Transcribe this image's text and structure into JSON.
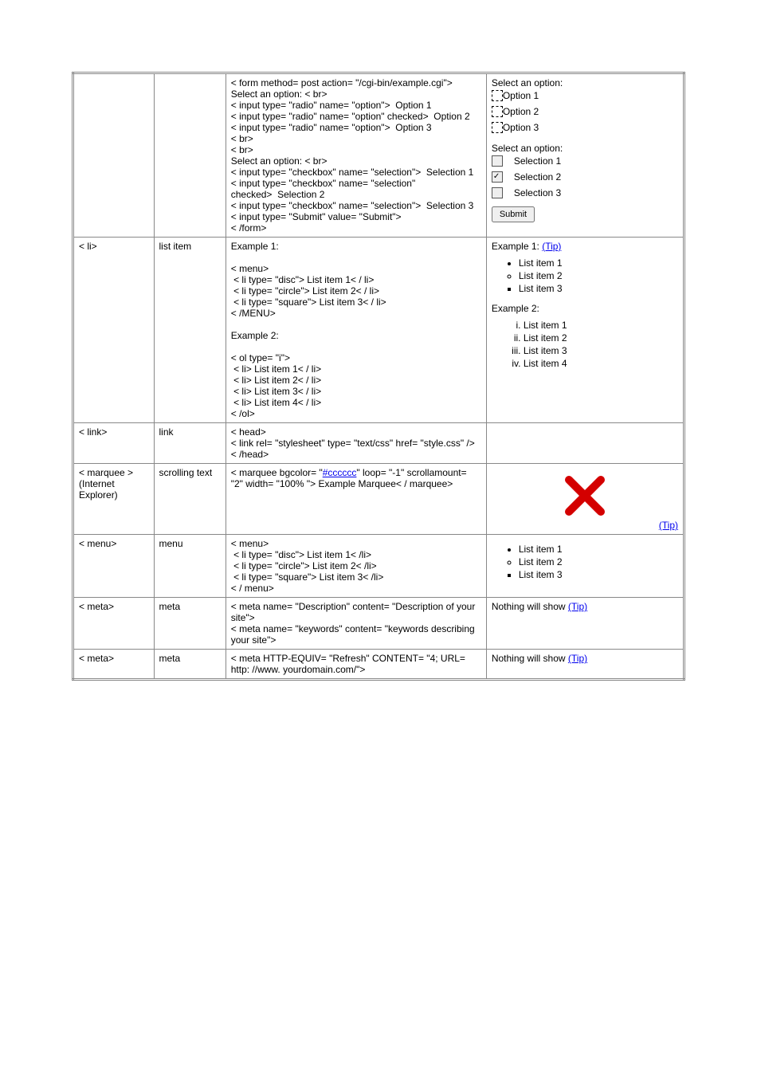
{
  "rows": {
    "form": {
      "code": "< form method= post action= \"/cgi-bin/example.cgi\">\nSelect an option: < br>\n< input type= \"radio\" name= \"option\">  Option 1\n< input type= \"radio\" name= \"option\" checked>  Option 2\n< input type= \"radio\" name= \"option\">  Option 3\n< br>\n< br>\nSelect an option: < br>\n< input type= \"checkbox\" name= \"selection\">  Selection 1\n< input type= \"checkbox\" name= \"selection\" checked>  Selection 2\n< input type= \"checkbox\" name= \"selection\">  Selection 3\n< input type= \"Submit\" value= \"Submit\">\n< /form>",
      "preview": {
        "radio_label": "Select an option:",
        "options": [
          "Option 1",
          "Option 2",
          "Option 3"
        ],
        "check_label": "Select an option:",
        "selections": [
          "Selection 1",
          "Selection 2",
          "Selection 3"
        ],
        "submit": "Submit"
      }
    },
    "li": {
      "tag": "< li>",
      "name": "list item",
      "code1_label": "Example 1:",
      "code1": "< menu>\n < li type= \"disc\"> List item 1< / li>\n < li type= \"circle\"> List item 2< / li>\n < li type= \"square\"> List item 3< / li>\n< /MENU>",
      "code2_label": "Example 2:",
      "code2": "< ol type= \"i\">\n < li> List item 1< / li>\n < li> List item 2< / li>\n < li> List item 3< / li>\n < li> List item 4< / li>\n< /ol>",
      "preview1_label": "Example 1:",
      "tip": "(Tip)",
      "list1": [
        "List item 1",
        "List item 2",
        "List item 3"
      ],
      "preview2_label": "Example 2:",
      "list2": [
        "List item 1",
        "List item 2",
        "List item 3",
        "List item 4"
      ]
    },
    "link": {
      "tag": "< link>",
      "name": "link",
      "code": "< head>\n< link rel= \"stylesheet\" type= \"text/css\" href= \"style.css\" />\n< /head>"
    },
    "marquee": {
      "tag": "< marquee >",
      "tag_note": "(Internet Explorer)",
      "name": "scrolling text",
      "code_pre": "< marquee bgcolor= \"",
      "code_link": "#cccccc",
      "code_post": "\" loop= \"-1\" scrollamount= \"2\" width= \"100% \"> Example Marquee< / marquee>",
      "tip": "(Tip)"
    },
    "menu": {
      "tag": "< menu>",
      "name": "menu",
      "code": "< menu>\n < li type= \"disc\"> List item 1< /li>\n < li type= \"circle\"> List item 2< /li>\n < li type= \"square\"> List item 3< /li>\n< / menu>",
      "list": [
        "List item 1",
        "List item 2",
        "List item 3"
      ]
    },
    "meta1": {
      "tag": "< meta>",
      "name": "meta",
      "code": "< meta name= \"Description\" content= \"Description of your site\">\n< meta name= \"keywords\" content= \"keywords describing your site\">",
      "preview": "Nothing will show",
      "tip": "(Tip)"
    },
    "meta2": {
      "tag": "< meta>",
      "name": "meta",
      "code": "< meta HTTP-EQUIV= \"Refresh\" CONTENT= \"4; URL= http: //www. yourdomain.com/\">",
      "preview": "Nothing will show",
      "tip": "(Tip)"
    }
  }
}
